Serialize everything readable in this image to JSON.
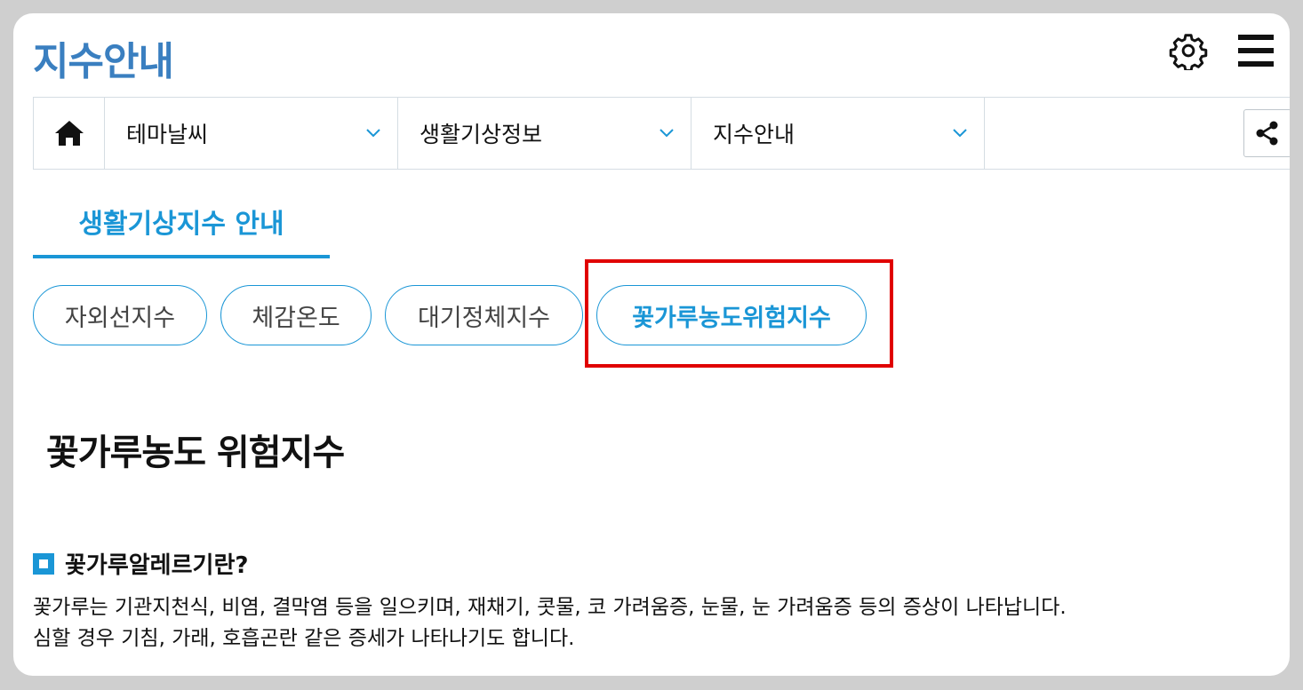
{
  "header": {
    "title": "지수안내",
    "settings_icon": "gear-icon",
    "menu_icon": "hamburger-menu-icon"
  },
  "breadcrumb": {
    "home_icon": "home-icon",
    "items": [
      {
        "label": "테마날씨"
      },
      {
        "label": "생활기상정보"
      },
      {
        "label": "지수안내"
      }
    ],
    "share_icon": "share-icon"
  },
  "section_tab": {
    "label": "생활기상지수 안내"
  },
  "pills": [
    {
      "label": "자외선지수",
      "active": false
    },
    {
      "label": "체감온도",
      "active": false
    },
    {
      "label": "대기정체지수",
      "active": false
    },
    {
      "label": "꽃가루농도위험지수",
      "active": true
    }
  ],
  "content": {
    "heading": "꽃가루농도 위험지수",
    "subheading": "꽃가루알레르기란?",
    "desc_line1": "꽃가루는 기관지천식, 비염, 결막염 등을 일으키며, 재채기, 콧물, 코 가려움증, 눈물, 눈 가려움증 등의 증상이 나타납니다.",
    "desc_line2": "심할 경우 기침, 가래, 호흡곤란 같은 증세가 나타나기도 합니다."
  },
  "colors": {
    "title_blue": "#3a7fc0",
    "accent_blue": "#1a96d6",
    "highlight_red": "#e00000",
    "background_gray": "#cfcfcf"
  }
}
